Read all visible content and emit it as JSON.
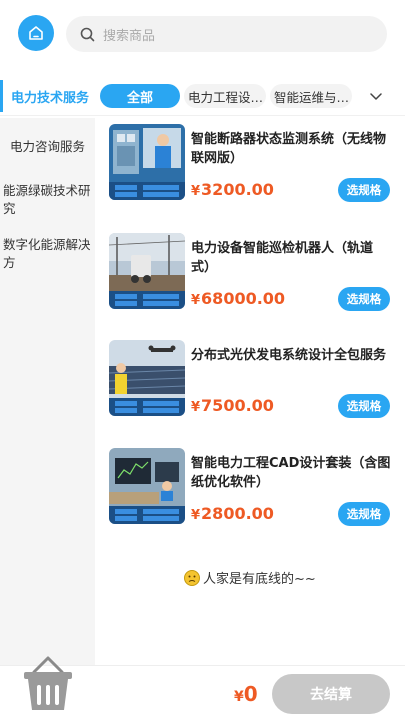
{
  "header": {
    "search_placeholder": "搜索商品"
  },
  "categories": {
    "active_side": "电力技术服务",
    "tabs": [
      {
        "label": "全部"
      },
      {
        "label": "电力工程设…"
      },
      {
        "label": "智能运维与…"
      }
    ]
  },
  "sidebar": {
    "items": [
      {
        "label": "电力咨询服务"
      },
      {
        "label": "能源绿碳技术研究"
      },
      {
        "label": "数字化能源解决方"
      }
    ]
  },
  "products": [
    {
      "name": "智能断路器状态监测系统（无线物联网版）",
      "currency": "¥",
      "price": "3200.00",
      "button": "选规格"
    },
    {
      "name": "电力设备智能巡检机器人（轨道式）",
      "currency": "¥",
      "price": "68000.00",
      "button": "选规格"
    },
    {
      "name": "分布式光伏发电系统设计全包服务",
      "currency": "¥",
      "price": "7500.00",
      "button": "选规格"
    },
    {
      "name": "智能电力工程CAD设计套装（含图纸优化软件）",
      "currency": "¥",
      "price": "2800.00",
      "button": "选规格"
    }
  ],
  "list_end_text": "人家是有底线的~~",
  "footer": {
    "currency": "¥",
    "total": "0",
    "checkout_label": "去结算"
  },
  "colors": {
    "accent": "#2aa6f2",
    "price": "#ee5a24",
    "checkout_disabled": "#c8c8c8"
  },
  "icons": [
    "home-icon",
    "search-icon",
    "chevron-down-icon",
    "cart-basket-icon",
    "sad-face-icon"
  ]
}
